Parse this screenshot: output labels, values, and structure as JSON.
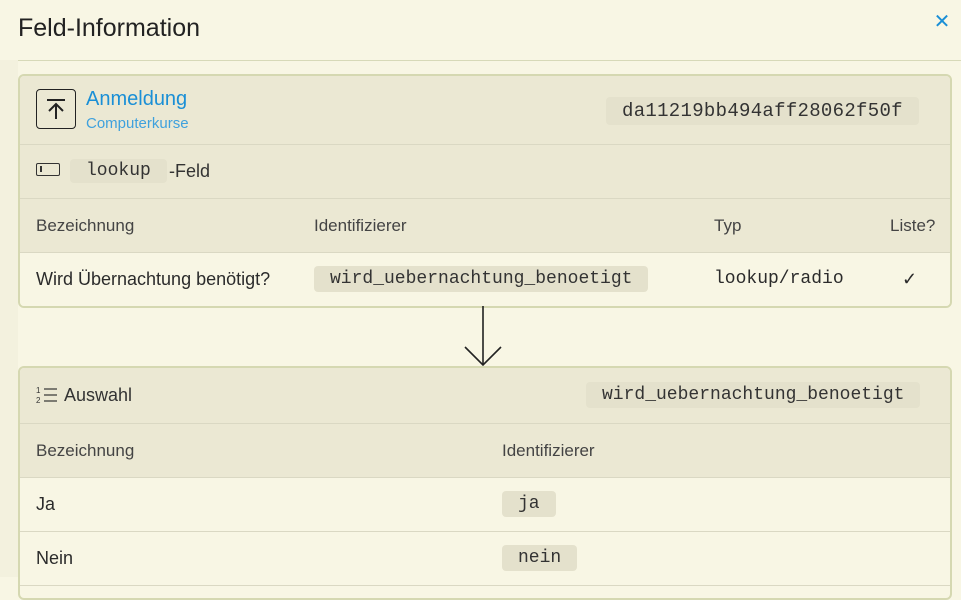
{
  "dialog": {
    "title": "Feld-Information",
    "close_icon": "close-icon",
    "ghost_text": "…"
  },
  "form": {
    "icon": "upload-arrow-icon",
    "name": "Anmeldung",
    "subtitle": "Computerkurse",
    "id": "da11219bb494aff28062f50f"
  },
  "field_type": {
    "icon": "text-field-icon",
    "code": "lookup",
    "suffix": "-Feld"
  },
  "field_table": {
    "headers": [
      "Bezeichnung",
      "Identifizierer",
      "Typ",
      "Liste?"
    ],
    "row": {
      "label": "Wird Übernachtung benötigt?",
      "identifier": "wird_uebernachtung_benoetigt",
      "type": "lookup/radio",
      "list": "✓"
    }
  },
  "arrow_icon": "arrow-down-icon",
  "options": {
    "icon": "numbered-list-icon",
    "label": "Auswahl",
    "id": "wird_uebernachtung_benoetigt",
    "headers": [
      "Bezeichnung",
      "Identifizierer"
    ],
    "rows": [
      {
        "label": "Ja",
        "identifier": "ja"
      },
      {
        "label": "Nein",
        "identifier": "nein"
      }
    ]
  },
  "colors": {
    "background": "#f8f6e4",
    "header_bg": "#ebe8d3",
    "border": "#d5d8b1",
    "link": "#1a8fd6"
  }
}
